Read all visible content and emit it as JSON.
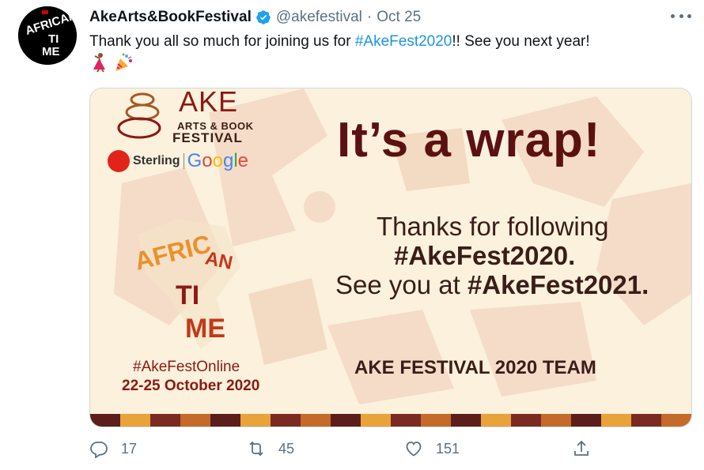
{
  "tweet": {
    "display_name": "AkeArts&BookFestival",
    "verified_icon": "verified-badge-icon",
    "handle": "@akefestival",
    "separator": "·",
    "date": "Oct 25",
    "text_before": "Thank you all so much for joining us for ",
    "hashtag": "#AkeFest2020",
    "text_after": "!! See you next year!",
    "emojis": [
      "dancer-emoji",
      "party-popper-emoji"
    ]
  },
  "image": {
    "ake_word": "AKE",
    "ake_sub1": "ARTS & BOOK",
    "ake_sub2": "FESTIVAL",
    "sponsor_sterling": "Sterling",
    "sponsor_google": "Google",
    "headline": "It’s a wrap!",
    "thanks_line": "Thanks for following",
    "tag_2020": "#AkeFest2020.",
    "see_you": "See you at ",
    "tag_2021": "#AkeFest2021.",
    "team": "AKE FESTIVAL 2020 TEAM",
    "online_tag": "#AkeFestOnline",
    "event_dates": "22-25 October 2020",
    "africa_word": "AFRICAN TIME"
  },
  "actions": {
    "reply_count": "17",
    "retweet_count": "45",
    "like_count": "151"
  },
  "colors": {
    "hashtag": "#1b95e0",
    "muted": "#5b7083",
    "verified": "#1da1f2",
    "headline": "#5c1111"
  }
}
